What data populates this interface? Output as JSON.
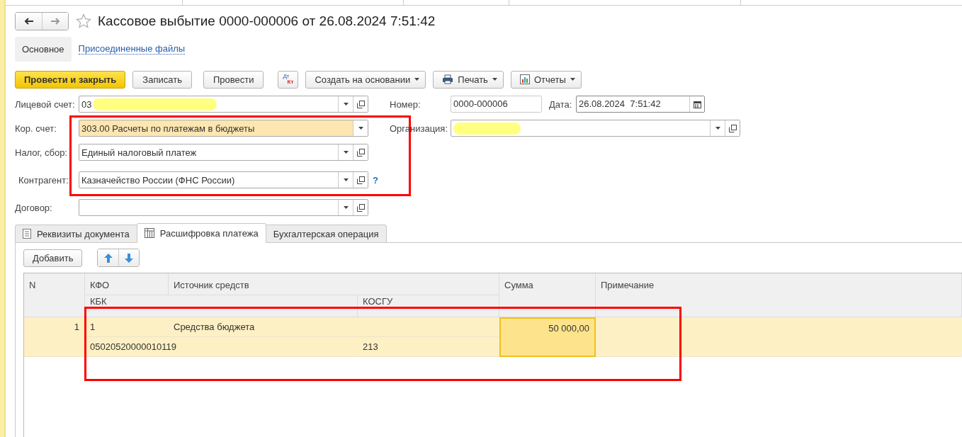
{
  "title": "Кассовое выбытие 0000-000006 от 26.08.2024 7:51:42",
  "favorite": false,
  "sections": [
    {
      "label": "Основное",
      "selected": true
    },
    {
      "label": "Присоединенные файлы",
      "selected": false
    }
  ],
  "toolbar": [
    {
      "kind": "primary",
      "label": "Провести и закрыть"
    },
    {
      "kind": "button",
      "label": "Записать"
    },
    {
      "kind": "button",
      "label": "Провести"
    },
    {
      "kind": "dtkt",
      "top": "Дт",
      "bottom": "Кт"
    },
    {
      "kind": "menu",
      "label": "Создать на основании"
    },
    {
      "kind": "printmenu",
      "label": "Печать"
    },
    {
      "kind": "reportmenu",
      "label": "Отчеты"
    }
  ],
  "fields": [
    {
      "label": "Лицевой счет:",
      "value": "03",
      "redacted": true,
      "highlighted": false,
      "open_button": true
    },
    {
      "label": "Кор. счет:",
      "value": "303.00 Расчеты по платежам в бюджеты",
      "redacted": false,
      "highlighted": true,
      "open_button": false
    },
    {
      "label": "Налог, сбор:",
      "value": "Единый налоговый платеж",
      "redacted": false,
      "highlighted": false,
      "open_button": true
    },
    {
      "label": "Контрагент:",
      "value": "Казначейство России (ФНС России)",
      "redacted": false,
      "highlighted": false,
      "open_button": true,
      "help_mark": "?"
    },
    {
      "label": "Договор:",
      "redacted": false,
      "highlighted": false,
      "open_button": true
    }
  ],
  "number": {
    "label": "Номер:",
    "value": "0000-000006"
  },
  "date": {
    "label": "Дата:",
    "value": "26.08.2024  7:51:42"
  },
  "organization": {
    "label": "Организация:",
    "redacted": true
  },
  "tabs": [
    {
      "label": "Реквизиты документа",
      "kind": "document",
      "selected": false
    },
    {
      "label": "Расшифровка платежа",
      "kind": "table",
      "selected": true
    },
    {
      "label": "Бухгалтерская операция",
      "kind": "plain",
      "selected": false
    }
  ],
  "add_button": "Добавить",
  "columns": {
    "n": "N",
    "kfo": "КФО",
    "source": "Источник средств",
    "sum": "Сумма",
    "note": "Примечание",
    "kbk": "КБК",
    "kosgu": "КОСГУ"
  },
  "rows": [
    {
      "n": "1",
      "kfo": "1",
      "source": "Средства бюджета",
      "kbk": "05020520000010119",
      "kosgu": "213",
      "sum": "50 000,00",
      "selected": true
    }
  ],
  "highlight_frames": [
    {
      "color": "#ff0000"
    },
    {
      "color": "#ff0000"
    }
  ]
}
